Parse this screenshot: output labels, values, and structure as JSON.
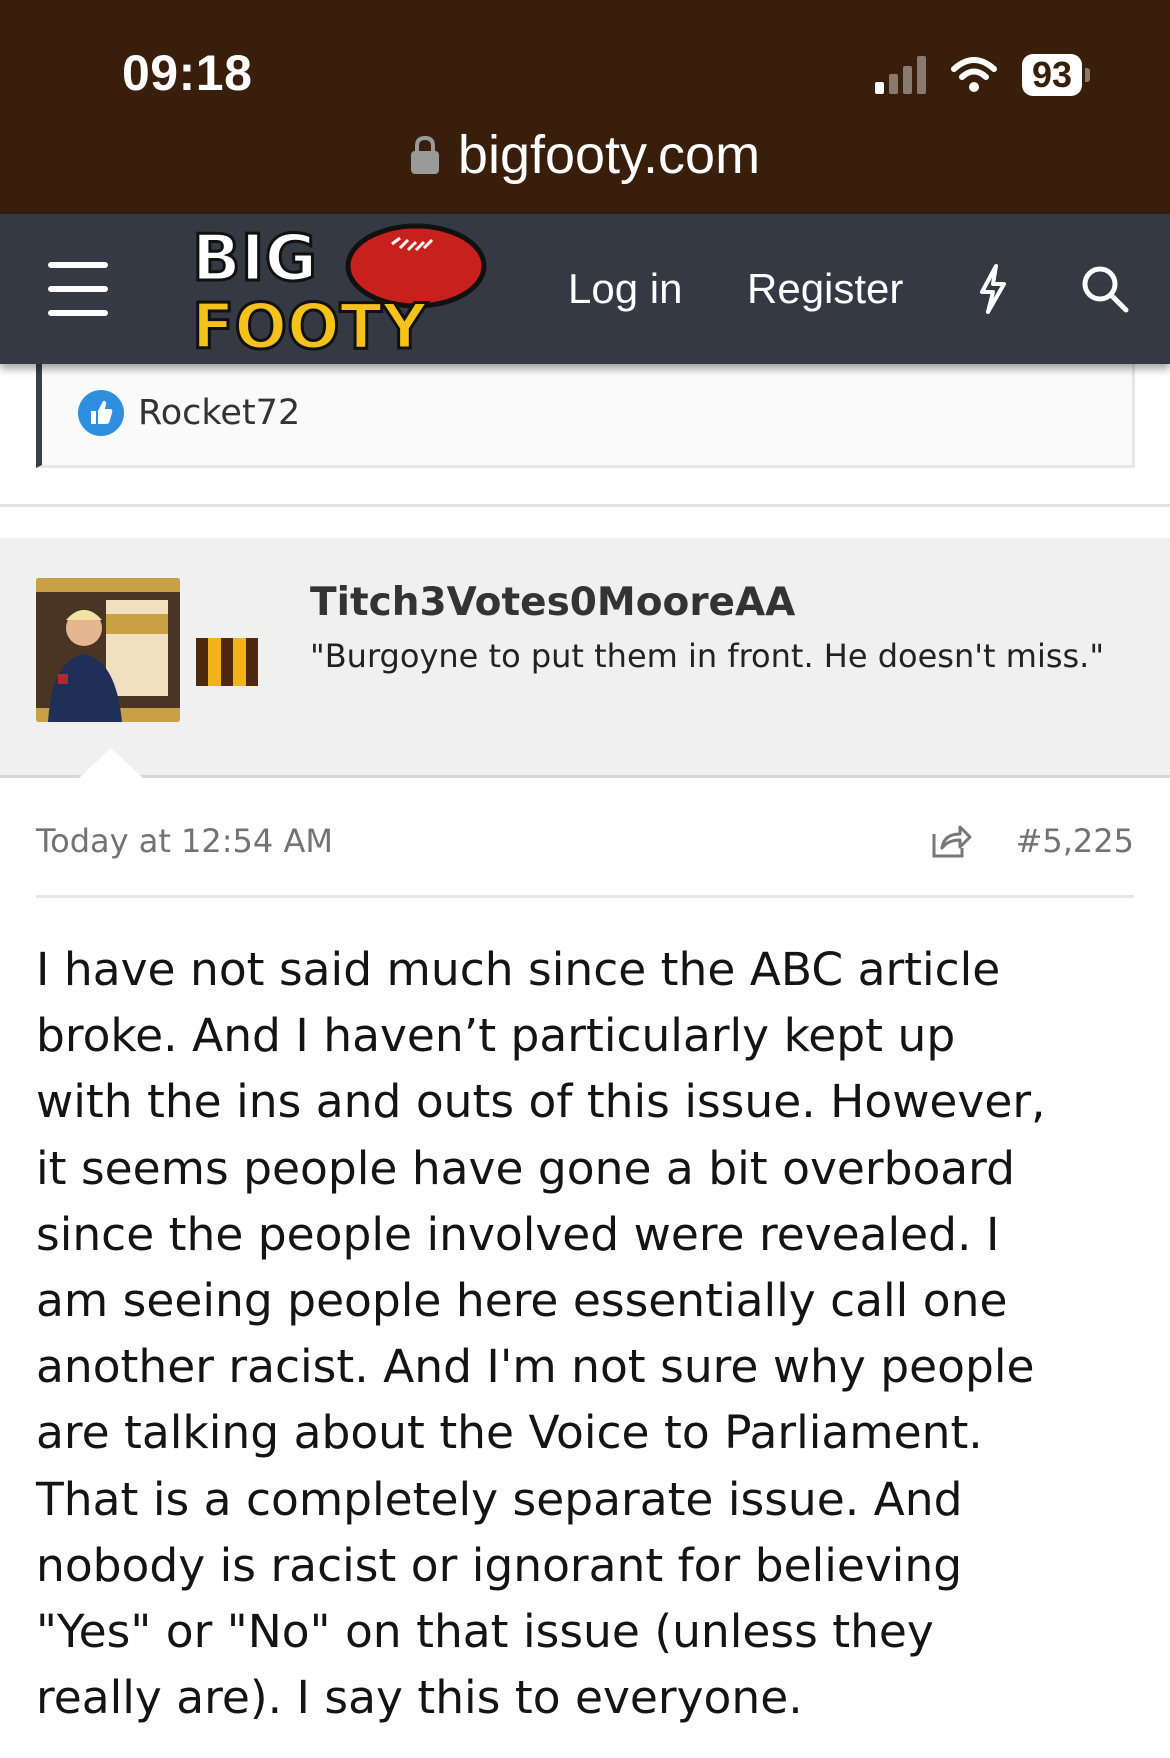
{
  "status_bar": {
    "time": "09:18",
    "battery": "93"
  },
  "browser": {
    "url": "bigfooty.com"
  },
  "header": {
    "logo_text": [
      "BIG",
      "FOOTY"
    ],
    "login_label": "Log in",
    "register_label": "Register"
  },
  "previous_post": {
    "reactor": "Rocket72"
  },
  "post": {
    "username": "Titch3Votes0MooreAA",
    "user_title": "\"Burgoyne to put them in front. He doesn't miss.\"",
    "timestamp": "Today at 12:54 AM",
    "post_number": "#5,225",
    "body_lines": [
      "I have not said much since the ABC article",
      "broke. And I haven’t particularly kept up",
      "with the ins and outs of this issue. However,",
      "it seems people have gone a bit overboard",
      "since the people involved were revealed. I",
      "am seeing people here essentially call one",
      "another racist. And I'm not sure why people",
      "are talking about the Voice to Parliament.",
      "That is a completely separate issue. And",
      "nobody is racist or ignorant for believing",
      "\"Yes\" or \"No\" on that issue (unless they",
      "really are). I say this to everyone."
    ]
  },
  "colors": {
    "chrome_brown": "#3a1e0c",
    "header_slate": "#343944",
    "logo_yellow": "#f4c21a",
    "like_blue": "#2f8ee0",
    "team_brown": "#4d2a0f",
    "team_gold": "#f1b21a"
  },
  "icons": [
    "lock-icon",
    "signal-icon",
    "wifi-icon",
    "battery-icon",
    "hamburger-menu-icon",
    "lightning-bolt-icon",
    "search-icon",
    "like-icon",
    "share-icon"
  ]
}
